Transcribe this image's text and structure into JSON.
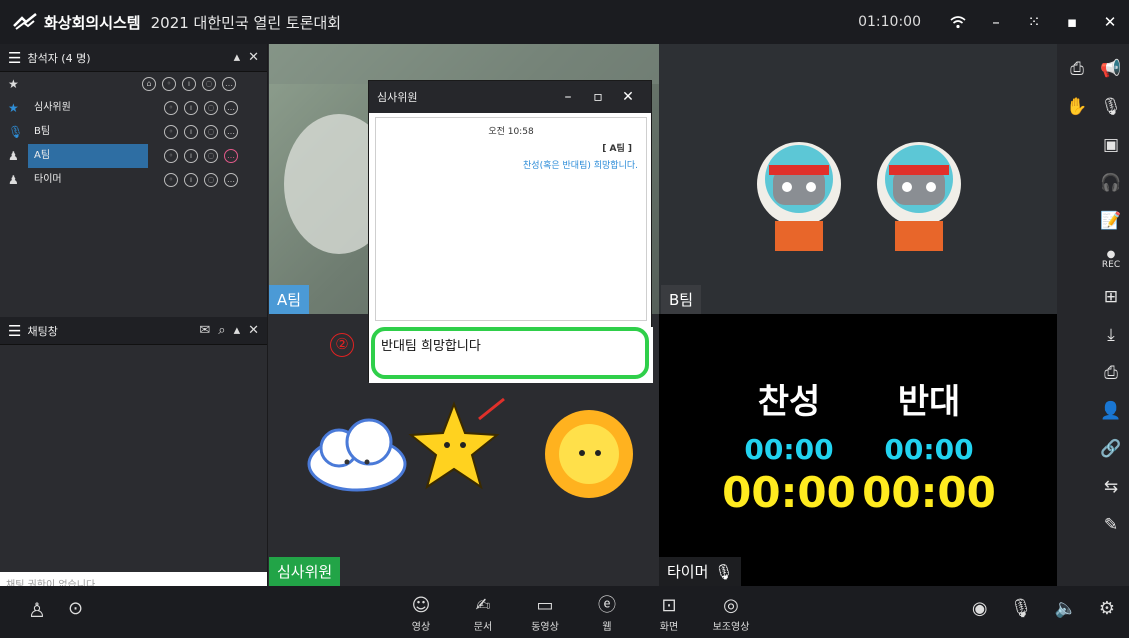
{
  "titlebar": {
    "app_title": "화상회의시스템",
    "event_title": "2021 대한민국 열린 토론대회",
    "timer": "01:10:00",
    "icons": [
      "wifi-icon",
      "minimize-icon",
      "fullscreen-icon",
      "maximize-icon",
      "close-icon"
    ]
  },
  "participants": {
    "title": "참석자 (4 명)",
    "rows": [
      {
        "name": "심사위원",
        "icon": "star-icon"
      },
      {
        "name": "B팀",
        "icon": "mic-icon"
      },
      {
        "name": "A팀",
        "icon": "person-icon",
        "selected": true
      },
      {
        "name": "타이머",
        "icon": "person-icon"
      }
    ]
  },
  "chat": {
    "title": "채팅창",
    "placeholder": "채팅 권한이 없습니다."
  },
  "videos": {
    "a_label": "A팀",
    "b_label": "B팀",
    "judge_label": "심사위원",
    "timer_label": "타이머"
  },
  "scoreboard": {
    "pro_label": "찬성",
    "con_label": "반대",
    "pro_small": "00:00",
    "con_small": "00:00",
    "pro_big": "00:00",
    "con_big": "00:00"
  },
  "dialog": {
    "title": "심사위원",
    "message_time": "오전 10:58",
    "message_sender": "[ A팀 ]",
    "message_text": "찬성(혹은 반대팀) 희망합니다.",
    "input_value": "반대팀 희망합니다",
    "marker": "②"
  },
  "bottom": {
    "items": [
      {
        "label": "영상",
        "icon": "emoji-icon"
      },
      {
        "label": "문서",
        "icon": "document-icon"
      },
      {
        "label": "동영상",
        "icon": "video-icon"
      },
      {
        "label": "웹",
        "icon": "web-icon"
      },
      {
        "label": "화면",
        "icon": "screen-share-icon"
      },
      {
        "label": "보조영상",
        "icon": "sub-video-icon"
      }
    ]
  },
  "right_toolbar": {
    "rec_label": "REC"
  }
}
